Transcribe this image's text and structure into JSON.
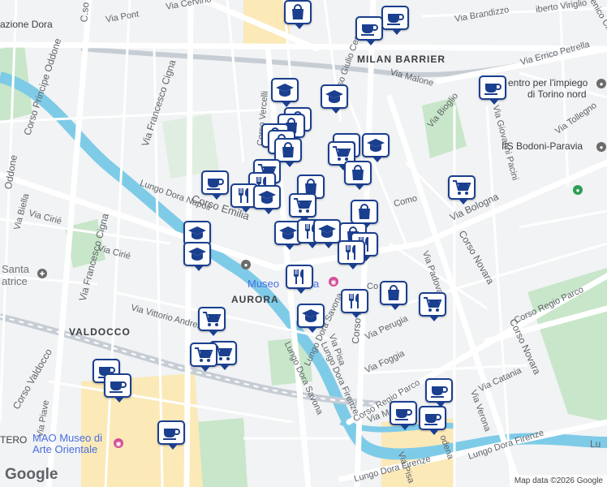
{
  "map": {
    "districts": [
      {
        "name": "MILAN BARRIER"
      },
      {
        "name": "AURORA"
      },
      {
        "name": "VALDOCCO"
      }
    ],
    "streets": [
      {
        "name": "Via Pont"
      },
      {
        "name": "Via Cervino"
      },
      {
        "name": "Via Brandizzo"
      },
      {
        "name": "Via Errico Petrella"
      },
      {
        "name": "Via Malone"
      },
      {
        "name": "Corso Giulio Cesare"
      },
      {
        "name": "Corso Vercelli"
      },
      {
        "name": "Via Francesco Cigna"
      },
      {
        "name": "Corso Principe Oddone"
      },
      {
        "name": "Lungo Dora Napoli"
      },
      {
        "name": "Corso Emilia"
      },
      {
        "name": "Via Cirié"
      },
      {
        "name": "Corso Novara"
      },
      {
        "name": "Via Bologna"
      },
      {
        "name": "Corso Regio Parco"
      },
      {
        "name": "Lungo Dora Firenze"
      },
      {
        "name": "Lungo Dora Savona"
      },
      {
        "name": "Via Vittorio Andreis"
      },
      {
        "name": "Via Pisa"
      },
      {
        "name": "Via Foggia"
      },
      {
        "name": "Via Catania"
      },
      {
        "name": "Via Perugia"
      },
      {
        "name": "Via Padova"
      },
      {
        "name": "Via Piave"
      },
      {
        "name": "Corso Valdocco"
      },
      {
        "name": "Via Giovanni Pacini"
      },
      {
        "name": "Via Bioglio"
      },
      {
        "name": "Via Tollegno"
      },
      {
        "name": "Via Biella"
      },
      {
        "name": "Como"
      },
      {
        "name": "Via Verona"
      }
    ],
    "places": {
      "station": "azione Dora",
      "centro_impiego_1": "entro per l'impiego",
      "centro_impiego_2": "di Torino nord",
      "iis": "IIS Bodoni-Paravia",
      "santa_1": "Santa",
      "santa_2": "atrice",
      "museo_1": "Museo",
      "museo_2": "a",
      "mao_1": "MAO Museo di",
      "mao_2": "Arte Orientale",
      "tero": "TERO",
      "c_so": "C.so",
      "oddone": "Oddone",
      "corso_p": "Corso P",
      "corso_prefix": "Co",
      "via_mes": "Via Mes",
      "odena": "odena",
      "lu": "Lu",
      "via_virgilio": "iberto Viriglio",
      "via_domenico": "omenico Cim"
    },
    "branding": {
      "logo": "Google",
      "attribution": "Map data ©2026 Google"
    },
    "colors": {
      "pin_border": "#1b3f8f",
      "pin_icon": "#1b3f8f",
      "river": "#7ecbe8",
      "park": "#c8e6c9",
      "road_major": "#ffffff",
      "highlight_area": "#fbe9b7"
    }
  },
  "pins": [
    {
      "type": "cafe"
    },
    {
      "type": "cafe"
    },
    {
      "type": "cafe"
    },
    {
      "type": "cafe"
    },
    {
      "type": "education"
    },
    {
      "type": "education"
    },
    {
      "type": "education"
    },
    {
      "type": "education"
    },
    {
      "type": "shopping"
    },
    {
      "type": "shopping"
    },
    {
      "type": "shopping"
    },
    {
      "type": "shopping"
    },
    {
      "type": "cart"
    },
    {
      "type": "cart"
    },
    {
      "type": "cart"
    },
    {
      "type": "cart"
    },
    {
      "type": "cart"
    },
    {
      "type": "restaurant"
    },
    {
      "type": "restaurant"
    },
    {
      "type": "restaurant"
    },
    {
      "type": "restaurant"
    },
    {
      "type": "education"
    },
    {
      "type": "education"
    },
    {
      "type": "shopping"
    },
    {
      "type": "cafe"
    },
    {
      "type": "cafe"
    },
    {
      "type": "cafe"
    },
    {
      "type": "cafe"
    },
    {
      "type": "cafe"
    },
    {
      "type": "cafe"
    },
    {
      "type": "cart"
    },
    {
      "type": "cart"
    },
    {
      "type": "cart"
    },
    {
      "type": "restaurant"
    },
    {
      "type": "restaurant"
    },
    {
      "type": "education"
    },
    {
      "type": "education"
    },
    {
      "type": "education"
    },
    {
      "type": "shopping"
    },
    {
      "type": "restaurant"
    },
    {
      "type": "cart"
    },
    {
      "type": "cafe"
    }
  ]
}
